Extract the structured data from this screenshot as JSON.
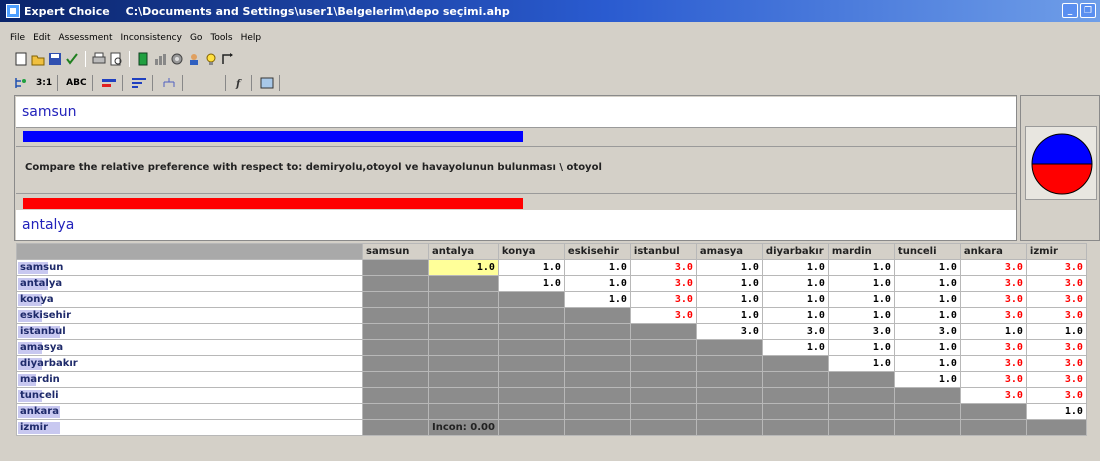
{
  "window": {
    "app_name": "Expert Choice",
    "file_path": "C:\\Documents and Settings\\user1\\Belgelerim\\depo seçimi.ahp"
  },
  "menu": [
    "File",
    "Edit",
    "Assessment",
    "Inconsistency",
    "Go",
    "Tools",
    "Help"
  ],
  "toolbar_tabs": [
    "3:1",
    "ABC"
  ],
  "compare": {
    "top_item": "samsun",
    "bottom_item": "antalya",
    "question": "Compare the relative preference with respect to: demiryolu,otoyol ve havayolunun bulunması \\ otoyol",
    "top_bar_fraction": 0.5,
    "bottom_bar_fraction": 0.5
  },
  "colors": {
    "blue": "#0000ff",
    "red": "#ff0000",
    "grey_cell": "#8c8c8c",
    "selected_cell": "#ffff99"
  },
  "grid": {
    "columns": [
      "samsun",
      "antalya",
      "konya",
      "eskisehir",
      "istanbul",
      "amasya",
      "diyarbakır",
      "mardin",
      "tunceli",
      "ankara",
      "izmir"
    ],
    "rows": [
      {
        "label": "samsun",
        "cells": [
          "",
          "1.0",
          "1.0",
          "1.0",
          "3.0",
          "1.0",
          "1.0",
          "1.0",
          "1.0",
          "3.0",
          "3.0"
        ]
      },
      {
        "label": "antalya",
        "cells": [
          "",
          "",
          "1.0",
          "1.0",
          "3.0",
          "1.0",
          "1.0",
          "1.0",
          "1.0",
          "3.0",
          "3.0"
        ]
      },
      {
        "label": "konya",
        "cells": [
          "",
          "",
          "",
          "1.0",
          "3.0",
          "1.0",
          "1.0",
          "1.0",
          "1.0",
          "3.0",
          "3.0"
        ]
      },
      {
        "label": "eskisehir",
        "cells": [
          "",
          "",
          "",
          "",
          "3.0",
          "1.0",
          "1.0",
          "1.0",
          "1.0",
          "3.0",
          "3.0"
        ]
      },
      {
        "label": "istanbul",
        "cells": [
          "",
          "",
          "",
          "",
          "",
          "3.0",
          "3.0",
          "3.0",
          "3.0",
          "1.0",
          "1.0"
        ]
      },
      {
        "label": "amasya",
        "cells": [
          "",
          "",
          "",
          "",
          "",
          "",
          "1.0",
          "1.0",
          "1.0",
          "3.0",
          "3.0"
        ]
      },
      {
        "label": "diyarbakır",
        "cells": [
          "",
          "",
          "",
          "",
          "",
          "",
          "",
          "1.0",
          "1.0",
          "3.0",
          "3.0"
        ]
      },
      {
        "label": "mardin",
        "cells": [
          "",
          "",
          "",
          "",
          "",
          "",
          "",
          "",
          "1.0",
          "3.0",
          "3.0"
        ]
      },
      {
        "label": "tunceli",
        "cells": [
          "",
          "",
          "",
          "",
          "",
          "",
          "",
          "",
          "",
          "3.0",
          "3.0"
        ]
      },
      {
        "label": "ankara",
        "cells": [
          "",
          "",
          "",
          "",
          "",
          "",
          "",
          "",
          "",
          "",
          "1.0"
        ]
      },
      {
        "label": "izmir",
        "cells": [
          "",
          "",
          "",
          "",
          "",
          "",
          "",
          "",
          "",
          "",
          ""
        ]
      }
    ],
    "red_cells": [
      [
        0,
        4
      ],
      [
        0,
        9
      ],
      [
        0,
        10
      ],
      [
        1,
        4
      ],
      [
        1,
        9
      ],
      [
        1,
        10
      ],
      [
        2,
        4
      ],
      [
        2,
        9
      ],
      [
        2,
        10
      ],
      [
        3,
        4
      ],
      [
        3,
        9
      ],
      [
        3,
        10
      ],
      [
        5,
        9
      ],
      [
        5,
        10
      ],
      [
        6,
        9
      ],
      [
        6,
        10
      ],
      [
        7,
        9
      ],
      [
        7,
        10
      ],
      [
        8,
        9
      ],
      [
        8,
        10
      ]
    ],
    "selected_cell": [
      0,
      1
    ],
    "label_highlight_fraction": [
      0.5,
      0.5,
      0.4,
      0.4,
      0.7,
      0.4,
      0.4,
      0.3,
      0.4,
      0.7,
      0.7
    ],
    "inconsistency_label": "Incon: 0.00"
  }
}
